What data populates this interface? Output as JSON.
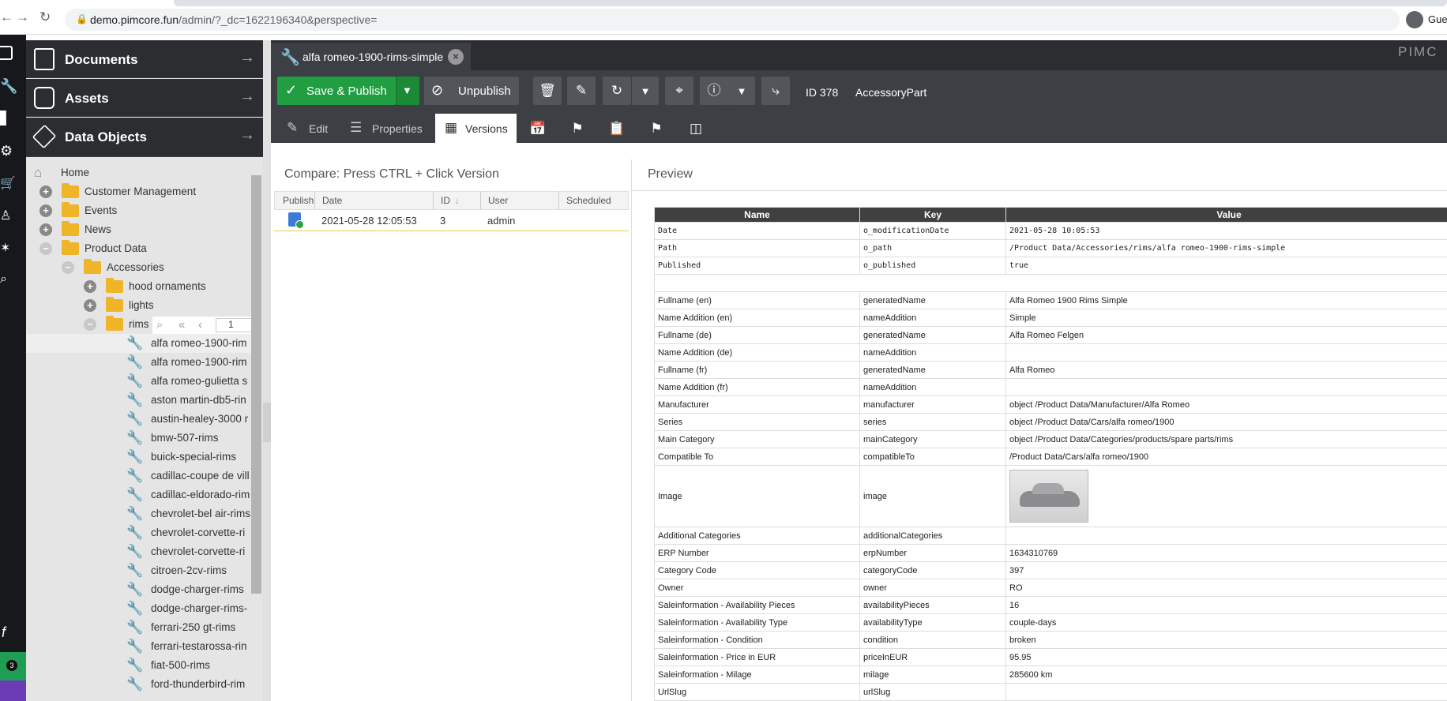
{
  "browser": {
    "url_host": "demo.pimcore.fun",
    "url_path": "/admin/?_dc=1622196340&perspective=",
    "profile_label": "Gue"
  },
  "sidebar": {
    "sections": [
      {
        "label": "Documents",
        "icon": "document-icon"
      },
      {
        "label": "Assets",
        "icon": "camera-icon"
      },
      {
        "label": "Data Objects",
        "icon": "cube-icon"
      }
    ]
  },
  "tree": {
    "home": "Home",
    "folders": [
      "Customer Management",
      "Events",
      "News",
      "Product Data",
      "Accessories",
      "hood ornaments",
      "lights",
      "rims"
    ],
    "pager_page": "1",
    "items": [
      "alfa romeo-1900-rim",
      "alfa romeo-1900-rim",
      "alfa romeo-gulietta s",
      "aston martin-db5-rin",
      "austin-healey-3000 r",
      "bmw-507-rims",
      "buick-special-rims",
      "cadillac-coupe de vill",
      "cadillac-eldorado-rim",
      "chevrolet-bel air-rims",
      "chevrolet-corvette-ri",
      "chevrolet-corvette-ri",
      "citroen-2cv-rims",
      "dodge-charger-rims",
      "dodge-charger-rims-",
      "ferrari-250 gt-rims",
      "ferrari-testarossa-rin",
      "fiat-500-rims",
      "ford-thunderbird-rim"
    ]
  },
  "tab": {
    "title": "alfa romeo-1900-rims-simple"
  },
  "brand": "PIMC",
  "toolbar": {
    "save_publish": "Save & Publish",
    "unpublish": "Unpublish",
    "id_label": "ID 378",
    "class_label": "AccessoryPart"
  },
  "subtabs": {
    "edit": "Edit",
    "properties": "Properties",
    "versions": "Versions"
  },
  "versions": {
    "heading": "Compare: Press CTRL + Click Version",
    "columns": [
      "Publish",
      "Date",
      "ID",
      "User",
      "Scheduled"
    ],
    "rows": [
      {
        "date": "2021-05-28 12:05:53",
        "id": "3",
        "user": "admin",
        "scheduled": ""
      }
    ]
  },
  "preview": {
    "heading": "Preview",
    "columns": [
      "Name",
      "Key",
      "Value"
    ],
    "system_rows": [
      {
        "name": "Date",
        "key": "o_modificationDate",
        "value": "2021-05-28 10:05:53"
      },
      {
        "name": "Path",
        "key": "o_path",
        "value": "/Product Data/Accessories/rims/alfa romeo-1900-rims-simple"
      },
      {
        "name": "Published",
        "key": "o_published",
        "value": "true"
      }
    ],
    "rows": [
      {
        "name": "Fullname (en)",
        "key": "generatedName",
        "value": "Alfa Romeo 1900 Rims Simple"
      },
      {
        "name": "Name Addition (en)",
        "key": "nameAddition",
        "value": "Simple"
      },
      {
        "name": "Fullname (de)",
        "key": "generatedName",
        "value": "Alfa Romeo Felgen"
      },
      {
        "name": "Name Addition (de)",
        "key": "nameAddition",
        "value": ""
      },
      {
        "name": "Fullname (fr)",
        "key": "generatedName",
        "value": "Alfa Romeo"
      },
      {
        "name": "Name Addition (fr)",
        "key": "nameAddition",
        "value": ""
      },
      {
        "name": "Manufacturer",
        "key": "manufacturer",
        "value": "object /Product Data/Manufacturer/Alfa Romeo"
      },
      {
        "name": "Series",
        "key": "series",
        "value": "object /Product Data/Cars/alfa romeo/1900"
      },
      {
        "name": "Main Category",
        "key": "mainCategory",
        "value": "object /Product Data/Categories/products/spare parts/rims"
      },
      {
        "name": "Compatible To",
        "key": "compatibleTo",
        "value": "/Product Data/Cars/alfa romeo/1900"
      }
    ],
    "image_row": {
      "name": "Image",
      "key": "image"
    },
    "rows2": [
      {
        "name": "Additional Categories",
        "key": "additionalCategories",
        "value": ""
      },
      {
        "name": "ERP Number",
        "key": "erpNumber",
        "value": "1634310769"
      },
      {
        "name": "Category Code",
        "key": "categoryCode",
        "value": "397"
      },
      {
        "name": "Owner",
        "key": "owner",
        "value": "RO"
      },
      {
        "name": "Saleinformation - Availability Pieces",
        "key": "availabilityPieces",
        "value": "16"
      },
      {
        "name": "Saleinformation - Availability Type",
        "key": "availabilityType",
        "value": "couple-days"
      },
      {
        "name": "Saleinformation - Condition",
        "key": "condition",
        "value": "broken"
      },
      {
        "name": "Saleinformation - Price in EUR",
        "key": "priceInEUR",
        "value": "95.95"
      },
      {
        "name": "Saleinformation - Milage",
        "key": "milage",
        "value": "285600 km"
      },
      {
        "name": "UrlSlug",
        "key": "urlSlug",
        "value": ""
      }
    ]
  },
  "notifications": {
    "count": "3"
  },
  "colors": {
    "accent_green": "#229e42",
    "dark_panel": "#2b2d30",
    "toolbar": "#3c3f43"
  }
}
